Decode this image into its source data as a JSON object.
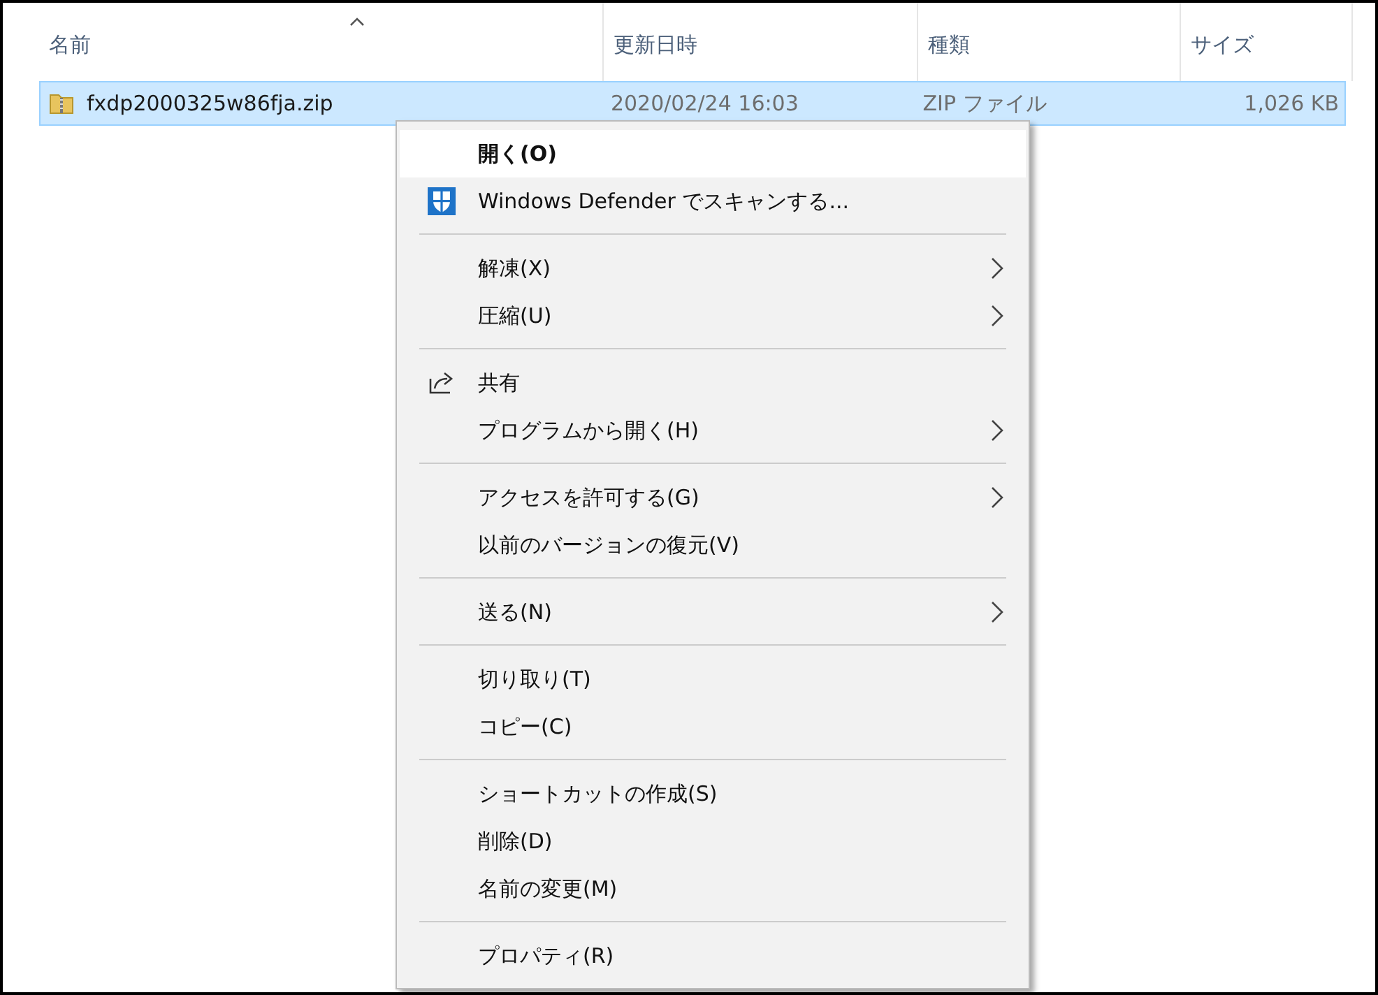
{
  "columns": [
    {
      "label": "名前",
      "sorted": true
    },
    {
      "label": "更新日時",
      "sorted": false
    },
    {
      "label": "種類",
      "sorted": false
    },
    {
      "label": "サイズ",
      "sorted": false
    }
  ],
  "files": [
    {
      "name": "fxdp2000325w86fja.zip",
      "modified": "2020/02/24 16:03",
      "type": "ZIP ファイル",
      "size": "1,026 KB",
      "selected": true
    }
  ],
  "context_menu": {
    "groups": [
      [
        {
          "label": "開く(O)",
          "default": true,
          "selected": true,
          "kind": "plain",
          "submenu": false
        },
        {
          "label": "Windows Defender でスキャンする...",
          "default": false,
          "selected": false,
          "kind": "shield",
          "submenu": false
        }
      ],
      [
        {
          "label": "解凍(X)",
          "default": false,
          "selected": false,
          "kind": "plain",
          "submenu": true
        },
        {
          "label": "圧縮(U)",
          "default": false,
          "selected": false,
          "kind": "plain",
          "submenu": true
        }
      ],
      [
        {
          "label": "共有",
          "default": false,
          "selected": false,
          "kind": "share",
          "submenu": false
        },
        {
          "label": "プログラムから開く(H)",
          "default": false,
          "selected": false,
          "kind": "plain",
          "submenu": true
        }
      ],
      [
        {
          "label": "アクセスを許可する(G)",
          "default": false,
          "selected": false,
          "kind": "plain",
          "submenu": true
        },
        {
          "label": "以前のバージョンの復元(V)",
          "default": false,
          "selected": false,
          "kind": "plain",
          "submenu": false
        }
      ],
      [
        {
          "label": "送る(N)",
          "default": false,
          "selected": false,
          "kind": "plain",
          "submenu": true
        }
      ],
      [
        {
          "label": "切り取り(T)",
          "default": false,
          "selected": false,
          "kind": "plain",
          "submenu": false
        },
        {
          "label": "コピー(C)",
          "default": false,
          "selected": false,
          "kind": "plain",
          "submenu": false
        }
      ],
      [
        {
          "label": "ショートカットの作成(S)",
          "default": false,
          "selected": false,
          "kind": "plain",
          "submenu": false
        },
        {
          "label": "削除(D)",
          "default": false,
          "selected": false,
          "kind": "plain",
          "submenu": false
        },
        {
          "label": "名前の変更(M)",
          "default": false,
          "selected": false,
          "kind": "plain",
          "submenu": false
        }
      ],
      [
        {
          "label": "プロパティ(R)",
          "default": false,
          "selected": false,
          "kind": "plain",
          "submenu": false
        }
      ]
    ]
  }
}
